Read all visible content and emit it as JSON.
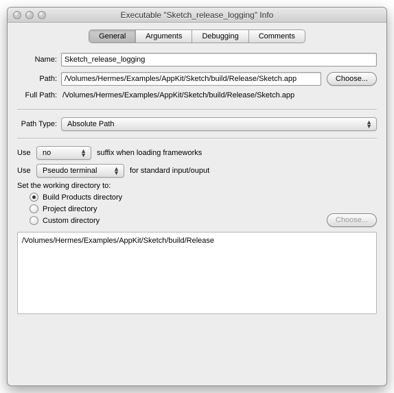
{
  "window": {
    "title": "Executable \"Sketch_release_logging\" Info"
  },
  "tabs": {
    "general": "General",
    "arguments": "Arguments",
    "debugging": "Debugging",
    "comments": "Comments",
    "selected": "general"
  },
  "labels": {
    "name": "Name:",
    "path": "Path:",
    "full_path": "Full Path:",
    "path_type": "Path Type:",
    "use": "Use",
    "suffix_text": "suffix when loading frameworks",
    "stdio_text": "for standard input/ouput",
    "set_workdir": "Set the working directory to:"
  },
  "fields": {
    "name": "Sketch_release_logging",
    "path": "/Volumes/Hermes/Examples/AppKit/Sketch/build/Release/Sketch.app",
    "full_path": "/Volumes/Hermes/Examples/AppKit/Sketch/build/Release/Sketch.app",
    "path_type": "Absolute Path",
    "suffix_value": "no",
    "stdio_value": "Pseudo terminal",
    "workdir_path": "/Volumes/Hermes/Examples/AppKit/Sketch/build/Release"
  },
  "buttons": {
    "choose": "Choose...",
    "choose2": "Choose..."
  },
  "radios": {
    "build_products": "Build Products directory",
    "project_dir": "Project directory",
    "custom_dir": "Custom directory",
    "selected": "build_products"
  }
}
